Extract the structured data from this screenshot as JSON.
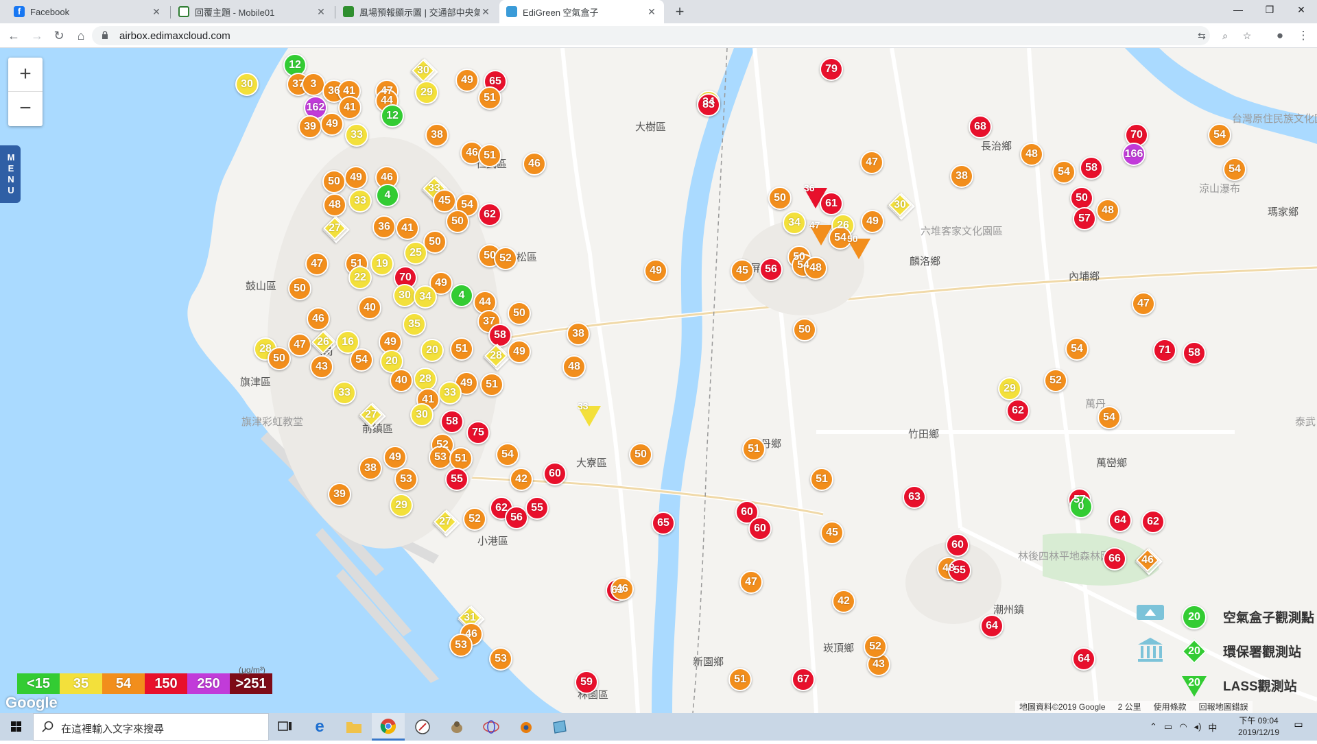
{
  "browser": {
    "tabs": [
      {
        "title": "Facebook",
        "active": false,
        "icon_color": "#1877f2"
      },
      {
        "title": "回覆主題 - Mobile01",
        "active": false,
        "icon_color": "#2e7d32"
      },
      {
        "title": "風場預報顯示圖 | 交通部中央氣象局",
        "active": false,
        "icon_color": "#2f8f2f"
      },
      {
        "title": "EdiGreen 空氣盒子",
        "active": true,
        "icon_color": "#3a9bd8"
      }
    ],
    "url": "airbox.edimaxcloud.com"
  },
  "map": {
    "places": [
      {
        "name": "大樹區"
      },
      {
        "name": "仁武區"
      },
      {
        "name": "鳥松區"
      },
      {
        "name": "鼓山區"
      },
      {
        "name": "旗津區"
      },
      {
        "name": "旗津彩虹教堂"
      },
      {
        "name": "前鎮區"
      },
      {
        "name": "小港區"
      },
      {
        "name": "大寮區"
      },
      {
        "name": "林園區"
      },
      {
        "name": "屏東市"
      },
      {
        "name": "萬丹鄉"
      },
      {
        "name": "麟洛鄉"
      },
      {
        "name": "六堆客家文化園區"
      },
      {
        "name": "內埔鄉"
      },
      {
        "name": "竹田鄉"
      },
      {
        "name": "長治鄉"
      },
      {
        "name": "瑪家鄉"
      },
      {
        "name": "涼山瀑布"
      },
      {
        "name": "台灣原住民族文化園區"
      },
      {
        "name": "萬巒鄉"
      },
      {
        "name": "萬丹"
      },
      {
        "name": "泰武"
      },
      {
        "name": "林後四林平地森林園區"
      },
      {
        "name": "潮州鎮"
      },
      {
        "name": "崁頂鄉"
      },
      {
        "name": "新園鄉"
      },
      {
        "name": "鳳山"
      },
      {
        "name": "高"
      }
    ],
    "legend": {
      "unit": "(μg/m³)",
      "bins": [
        {
          "label": "<15",
          "color": "#33cc33"
        },
        {
          "label": "35",
          "color": "#f3e03b"
        },
        {
          "label": "54",
          "color": "#f28e1c"
        },
        {
          "label": "150",
          "color": "#e8102c"
        },
        {
          "label": "250",
          "color": "#c13bd9"
        },
        {
          "label": ">251",
          "color": "#7e0b17"
        }
      ]
    },
    "station_legend": [
      {
        "label": "空氣盒子觀測點",
        "value": "20",
        "icon": "airbox-icon"
      },
      {
        "label": "環保署觀測站",
        "value": "20",
        "icon": "government-building-icon"
      },
      {
        "label": "LASS觀測站",
        "value": "20",
        "icon": "lass-station-icon"
      }
    ],
    "footer": {
      "data_credit": "地圖資料©2019 Google",
      "scale": "2 公里",
      "terms": "使用條款",
      "report": "回報地圖錯誤"
    },
    "zoom_in": "+",
    "zoom_out": "−",
    "menu_label": "MENU",
    "google_logo": "Google",
    "markers": [
      [
        "12",
        "g",
        "c"
      ],
      [
        "30",
        "y",
        "c"
      ],
      [
        "37",
        "o",
        "c"
      ],
      [
        "3",
        "o",
        "c"
      ],
      [
        "36",
        "o",
        "c"
      ],
      [
        "41",
        "o",
        "c"
      ],
      [
        "47",
        "o",
        "c"
      ],
      [
        "30",
        "y",
        "d"
      ],
      [
        "49",
        "o",
        "c"
      ],
      [
        "65",
        "r",
        "c"
      ],
      [
        "29",
        "y",
        "c"
      ],
      [
        "162",
        "p",
        "c"
      ],
      [
        "41",
        "o",
        "c"
      ],
      [
        "44",
        "o",
        "c"
      ],
      [
        "51",
        "o",
        "c"
      ],
      [
        "39",
        "o",
        "c"
      ],
      [
        "49",
        "o",
        "c"
      ],
      [
        "33",
        "y",
        "c"
      ],
      [
        "12",
        "g",
        "c"
      ],
      [
        "38",
        "o",
        "c"
      ],
      [
        "46",
        "o",
        "c"
      ],
      [
        "51",
        "o",
        "c"
      ],
      [
        "46",
        "o",
        "c"
      ],
      [
        "34",
        "y",
        "c"
      ],
      [
        "49",
        "o",
        "c"
      ],
      [
        "50",
        "o",
        "c"
      ],
      [
        "46",
        "o",
        "c"
      ],
      [
        "33",
        "y",
        "d"
      ],
      [
        "33",
        "y",
        "c"
      ],
      [
        "4",
        "g",
        "c"
      ],
      [
        "48",
        "o",
        "c"
      ],
      [
        "45",
        "o",
        "c"
      ],
      [
        "54",
        "o",
        "c"
      ],
      [
        "62",
        "r",
        "c"
      ],
      [
        "27",
        "y",
        "d"
      ],
      [
        "36",
        "o",
        "c"
      ],
      [
        "41",
        "o",
        "c"
      ],
      [
        "50",
        "o",
        "c"
      ],
      [
        "50",
        "o",
        "c"
      ],
      [
        "25",
        "y",
        "c"
      ],
      [
        "47",
        "o",
        "c"
      ],
      [
        "51",
        "o",
        "c"
      ],
      [
        "19",
        "y",
        "c"
      ],
      [
        "50",
        "o",
        "c"
      ],
      [
        "52",
        "o",
        "c"
      ],
      [
        "22",
        "y",
        "c"
      ],
      [
        "70",
        "r",
        "c"
      ],
      [
        "49",
        "o",
        "c"
      ],
      [
        "50",
        "o",
        "c"
      ],
      [
        "30",
        "y",
        "c"
      ],
      [
        "34",
        "y",
        "c"
      ],
      [
        "4",
        "g",
        "c"
      ],
      [
        "44",
        "o",
        "c"
      ],
      [
        "40",
        "o",
        "c"
      ],
      [
        "50",
        "o",
        "c"
      ],
      [
        "46",
        "o",
        "c"
      ],
      [
        "37",
        "o",
        "c"
      ],
      [
        "35",
        "y",
        "c"
      ],
      [
        "47",
        "o",
        "c"
      ],
      [
        "26",
        "y",
        "d"
      ],
      [
        "16",
        "y",
        "c"
      ],
      [
        "49",
        "o",
        "c"
      ],
      [
        "58",
        "r",
        "c"
      ],
      [
        "51",
        "o",
        "c"
      ],
      [
        "28",
        "y",
        "d"
      ],
      [
        "49",
        "o",
        "c"
      ],
      [
        "28",
        "y",
        "c"
      ],
      [
        "50",
        "o",
        "c"
      ],
      [
        "54",
        "o",
        "c"
      ],
      [
        "43",
        "o",
        "c"
      ],
      [
        "20",
        "y",
        "c"
      ],
      [
        "20",
        "y",
        "c"
      ],
      [
        "49",
        "o",
        "c"
      ],
      [
        "28",
        "y",
        "c"
      ],
      [
        "40",
        "o",
        "c"
      ],
      [
        "51",
        "o",
        "c"
      ],
      [
        "33",
        "y",
        "c"
      ],
      [
        "33",
        "y",
        "c"
      ],
      [
        "41",
        "o",
        "c"
      ],
      [
        "27",
        "y",
        "d"
      ],
      [
        "30",
        "y",
        "c"
      ],
      [
        "58",
        "r",
        "c"
      ],
      [
        "75",
        "r",
        "c"
      ],
      [
        "52",
        "o",
        "c"
      ],
      [
        "53",
        "o",
        "c"
      ],
      [
        "49",
        "o",
        "c"
      ],
      [
        "51",
        "o",
        "c"
      ],
      [
        "38",
        "o",
        "c"
      ],
      [
        "53",
        "o",
        "c"
      ],
      [
        "55",
        "r",
        "c"
      ],
      [
        "54",
        "o",
        "c"
      ],
      [
        "42",
        "o",
        "c"
      ],
      [
        "60",
        "r",
        "c"
      ],
      [
        "39",
        "o",
        "c"
      ],
      [
        "29",
        "y",
        "c"
      ],
      [
        "27",
        "y",
        "d"
      ],
      [
        "52",
        "o",
        "c"
      ],
      [
        "62",
        "r",
        "c"
      ],
      [
        "56",
        "r",
        "c"
      ],
      [
        "55",
        "r",
        "c"
      ],
      [
        "38",
        "o",
        "c"
      ],
      [
        "48",
        "o",
        "c"
      ],
      [
        "33",
        "y",
        "t"
      ],
      [
        "50",
        "o",
        "c"
      ],
      [
        "49",
        "o",
        "c"
      ],
      [
        "65",
        "r",
        "c"
      ],
      [
        "63",
        "r",
        "c"
      ],
      [
        "31",
        "y",
        "d"
      ],
      [
        "46",
        "o",
        "c"
      ],
      [
        "46",
        "o",
        "c"
      ],
      [
        "53",
        "o",
        "c"
      ],
      [
        "53",
        "o",
        "c"
      ],
      [
        "59",
        "r",
        "c"
      ],
      [
        "83",
        "r",
        "c"
      ],
      [
        "79",
        "r",
        "c"
      ],
      [
        "50",
        "o",
        "c"
      ],
      [
        "34",
        "y",
        "c"
      ],
      [
        "36",
        "r",
        "t"
      ],
      [
        "47",
        "o",
        "t"
      ],
      [
        "26",
        "y",
        "c"
      ],
      [
        "49",
        "o",
        "c"
      ],
      [
        "54",
        "o",
        "c"
      ],
      [
        "30",
        "y",
        "d"
      ],
      [
        "47",
        "o",
        "c"
      ],
      [
        "38",
        "o",
        "c"
      ],
      [
        "61",
        "r",
        "c"
      ],
      [
        "50",
        "o",
        "t"
      ],
      [
        "50",
        "o",
        "c"
      ],
      [
        "56",
        "r",
        "c"
      ],
      [
        "54",
        "o",
        "c"
      ],
      [
        "48",
        "o",
        "c"
      ],
      [
        "50",
        "o",
        "c"
      ],
      [
        "45",
        "o",
        "c"
      ],
      [
        "51",
        "o",
        "c"
      ],
      [
        "51",
        "o",
        "c"
      ],
      [
        "60",
        "r",
        "c"
      ],
      [
        "60",
        "r",
        "c"
      ],
      [
        "45",
        "o",
        "c"
      ],
      [
        "47",
        "o",
        "c"
      ],
      [
        "51",
        "o",
        "c"
      ],
      [
        "67",
        "r",
        "c"
      ],
      [
        "43",
        "o",
        "c"
      ],
      [
        "42",
        "o",
        "c"
      ],
      [
        "52",
        "o",
        "c"
      ],
      [
        "63",
        "r",
        "c"
      ],
      [
        "60",
        "r",
        "c"
      ],
      [
        "48",
        "o",
        "c"
      ],
      [
        "55",
        "r",
        "c"
      ],
      [
        "68",
        "r",
        "c"
      ],
      [
        "48",
        "o",
        "c"
      ],
      [
        "54",
        "o",
        "c"
      ],
      [
        "58",
        "r",
        "c"
      ],
      [
        "50",
        "r",
        "c"
      ],
      [
        "57",
        "r",
        "c"
      ],
      [
        "48",
        "o",
        "c"
      ],
      [
        "70",
        "r",
        "c"
      ],
      [
        "166",
        "p",
        "c"
      ],
      [
        "54",
        "o",
        "c"
      ],
      [
        "54",
        "o",
        "c"
      ],
      [
        "47",
        "o",
        "c"
      ],
      [
        "54",
        "o",
        "c"
      ],
      [
        "71",
        "r",
        "c"
      ],
      [
        "58",
        "r",
        "c"
      ],
      [
        "52",
        "o",
        "c"
      ],
      [
        "29",
        "y",
        "c"
      ],
      [
        "62",
        "r",
        "c"
      ],
      [
        "54",
        "o",
        "c"
      ],
      [
        "57",
        "r",
        "c"
      ],
      [
        "64",
        "r",
        "c"
      ],
      [
        "0",
        "g",
        "c"
      ],
      [
        "62",
        "r",
        "c"
      ],
      [
        "66",
        "r",
        "c"
      ],
      [
        "46",
        "o",
        "d"
      ],
      [
        "64",
        "r",
        "c"
      ],
      [
        "64",
        "r",
        "c"
      ]
    ]
  },
  "taskbar": {
    "search_placeholder": "在這裡輸入文字來搜尋",
    "time": "下午 09:04",
    "date": "2019/12/19",
    "ime": "中"
  }
}
